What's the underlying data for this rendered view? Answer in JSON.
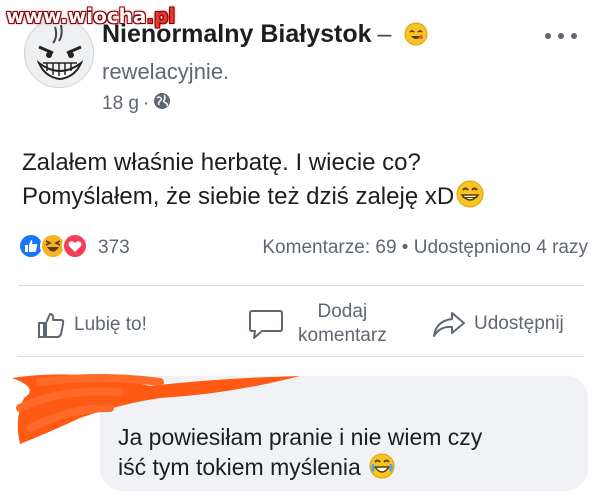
{
  "watermark": {
    "prefix": "www.",
    "name": "wiocha",
    "suffix": ".pl"
  },
  "post": {
    "page_name": "Nienormalny Białystok",
    "dash": "–",
    "feeling_text": "rewelacyjnie.",
    "time": "18 g",
    "separator": "·",
    "privacy_icon": "globe-icon",
    "more_icon": "more-options-icon",
    "text_line1": "Zalałem właśnie herbatę. I wiecie co?",
    "text_line2": "Pomyślałem, że siebie też dziś zaleję xD"
  },
  "stats": {
    "reaction_icons": [
      "like-reaction-icon",
      "haha-reaction-icon",
      "love-reaction-icon"
    ],
    "reaction_count": "373",
    "comments_shares": "Komentarze: 69 • Udostępniono 4 razy"
  },
  "actions": {
    "like_label": "Lubię to!",
    "comment_label_line1": "Dodaj",
    "comment_label_line2": "komentarz",
    "share_label": "Udostępnij"
  },
  "comment": {
    "line1": "Ja powiesiłam pranie i nie wiem czy",
    "line2": "iść tym tokiem myślenia"
  },
  "colors": {
    "like_blue": "#1877f2",
    "love_red": "#f33e58",
    "haha_yellow": "#f7b125",
    "scribble_orange": "#ff5a14",
    "bubble_gray": "#f0f2f5",
    "text_gray": "#606770"
  }
}
